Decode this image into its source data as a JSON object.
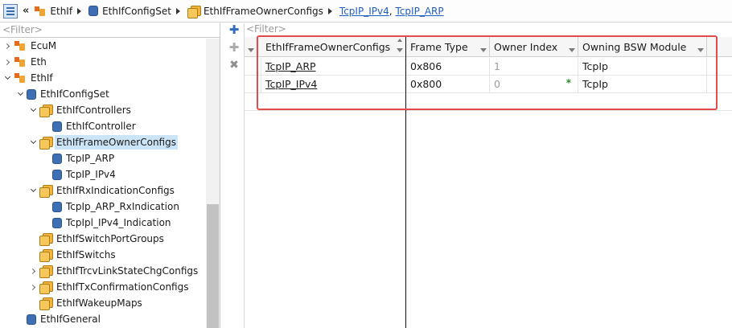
{
  "breadcrumb": {
    "items": [
      "EthIf",
      "EthIfConfigSet",
      "EthIfFrameOwnerConfigs"
    ],
    "links": [
      "TcpIP_IPv4",
      "TcpIP_ARP"
    ],
    "comma": ","
  },
  "tree": {
    "filter_placeholder": "<Filter>",
    "items": [
      {
        "label": "EcuM",
        "level": 0,
        "expander": "collapsed",
        "icon": "module-icon"
      },
      {
        "label": "Eth",
        "level": 0,
        "expander": "collapsed",
        "icon": "module-icon"
      },
      {
        "label": "EthIf",
        "level": 0,
        "expander": "expanded",
        "icon": "module-icon"
      },
      {
        "label": "EthIfConfigSet",
        "level": 1,
        "expander": "expanded",
        "icon": "container-icon"
      },
      {
        "label": "EthIfControllers",
        "level": 2,
        "expander": "expanded",
        "icon": "multi-container-icon"
      },
      {
        "label": "EthIfController",
        "level": 3,
        "expander": "none",
        "icon": "container-icon"
      },
      {
        "label": "EthIfFrameOwnerConfigs",
        "level": 2,
        "expander": "expanded",
        "icon": "multi-container-icon",
        "selected": true
      },
      {
        "label": "TcpIP_ARP",
        "level": 3,
        "expander": "none",
        "icon": "container-icon"
      },
      {
        "label": "TcpIP_IPv4",
        "level": 3,
        "expander": "none",
        "icon": "container-icon"
      },
      {
        "label": "EthIfRxIndicationConfigs",
        "level": 2,
        "expander": "expanded",
        "icon": "multi-container-icon"
      },
      {
        "label": "TcpIp_ARP_RxIndication",
        "level": 3,
        "expander": "none",
        "icon": "container-icon"
      },
      {
        "label": "TcpIpl_IPv4_Indication",
        "level": 3,
        "expander": "none",
        "icon": "container-icon"
      },
      {
        "label": "EthIfSwitchPortGroups",
        "level": 2,
        "expander": "none",
        "icon": "multi-container-icon"
      },
      {
        "label": "EthIfSwitchs",
        "level": 2,
        "expander": "none",
        "icon": "multi-container-icon"
      },
      {
        "label": "EthIfTrcvLinkStateChgConfigs",
        "level": 2,
        "expander": "collapsed",
        "icon": "multi-container-icon"
      },
      {
        "label": "EthIfTxConfirmationConfigs",
        "level": 2,
        "expander": "collapsed",
        "icon": "multi-container-icon"
      },
      {
        "label": "EthIfWakeupMaps",
        "level": 2,
        "expander": "none",
        "icon": "multi-container-icon"
      },
      {
        "label": "EthIfGeneral",
        "level": 1,
        "expander": "none",
        "icon": "container-icon"
      }
    ]
  },
  "toolbar": {
    "add_icon": "add-element-icon",
    "add_child_icon": "add-child-icon",
    "delete_icon": "delete-icon"
  },
  "table": {
    "filter_placeholder": "<Filter>",
    "columns": [
      "EthIfFrameOwnerConfigs",
      "Frame Type",
      "Owner Index",
      "Owning BSW Module"
    ],
    "rows": [
      {
        "name": "TcpIP_ARP",
        "frame_type": "0x806",
        "owner_index": "1",
        "module": "TcpIp",
        "modified": ""
      },
      {
        "name": "TcpIP_IPv4",
        "frame_type": "0x800",
        "owner_index": "0",
        "module": "TcpIp",
        "modified": "*"
      }
    ],
    "highlight_color": "#e34c4c"
  }
}
